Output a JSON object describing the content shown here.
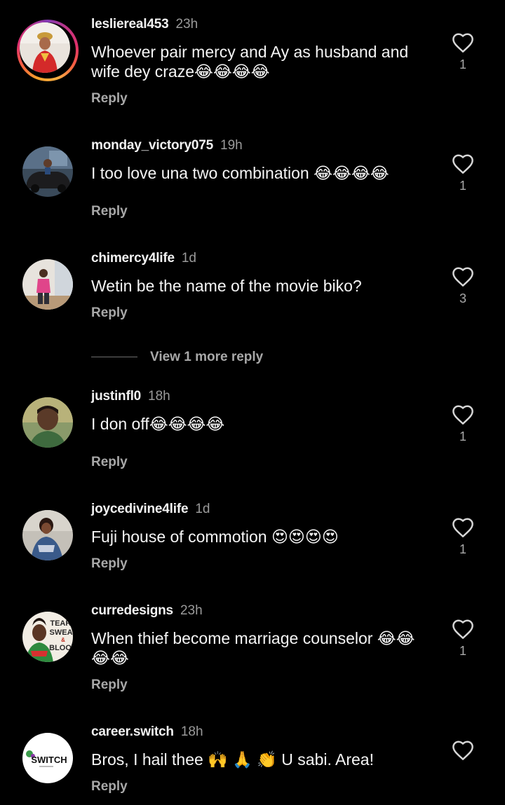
{
  "comments": [
    {
      "username": "lesliereal453",
      "time": "23h",
      "text_line1": "Whoever pair mercy and Ay as husband and",
      "text_line2": "wife dey craze😂😂😂😂",
      "reply_label": "Reply",
      "likes": "1",
      "has_story": true
    },
    {
      "username": "monday_victory075",
      "time": "19h",
      "text_line1": "I too love una two combination 😂😂😂😂",
      "reply_label": "Reply",
      "likes": "1"
    },
    {
      "username": "chimercy4life",
      "time": "1d",
      "text_line1": "Wetin be the name of the movie biko?",
      "reply_label": "Reply",
      "likes": "3"
    },
    {
      "username": "justinfl0",
      "time": "18h",
      "text_line1": "I don off😂😂😂😂",
      "reply_label": "Reply",
      "likes": "1"
    },
    {
      "username": "joycedivine4life",
      "time": "1d",
      "text_line1": "Fuji house of commotion 😍😍😍😍",
      "reply_label": "Reply",
      "likes": "1"
    },
    {
      "username": "curredesigns",
      "time": "23h",
      "text_line1": "When thief become marriage counselor 😂😂",
      "text_line2": "😂😂",
      "reply_label": "Reply",
      "likes": "1",
      "avatar_text": [
        "TEARS",
        "SWEAT",
        "&",
        "BLOOD"
      ]
    },
    {
      "username": "career.switch",
      "time": "18h",
      "text_line1": "Bros, I hail thee 🙌 🙏 👏 U sabi. Area!",
      "reply_label": "Reply",
      "likes": "",
      "avatar_text": "SWITCH"
    }
  ],
  "view_more": {
    "label": "View 1 more reply"
  },
  "icons": {
    "like": "heart-outline-icon"
  },
  "colors": {
    "background": "#000000",
    "primary_text": "#f5f5f5",
    "secondary_text": "#a8a8a8"
  }
}
